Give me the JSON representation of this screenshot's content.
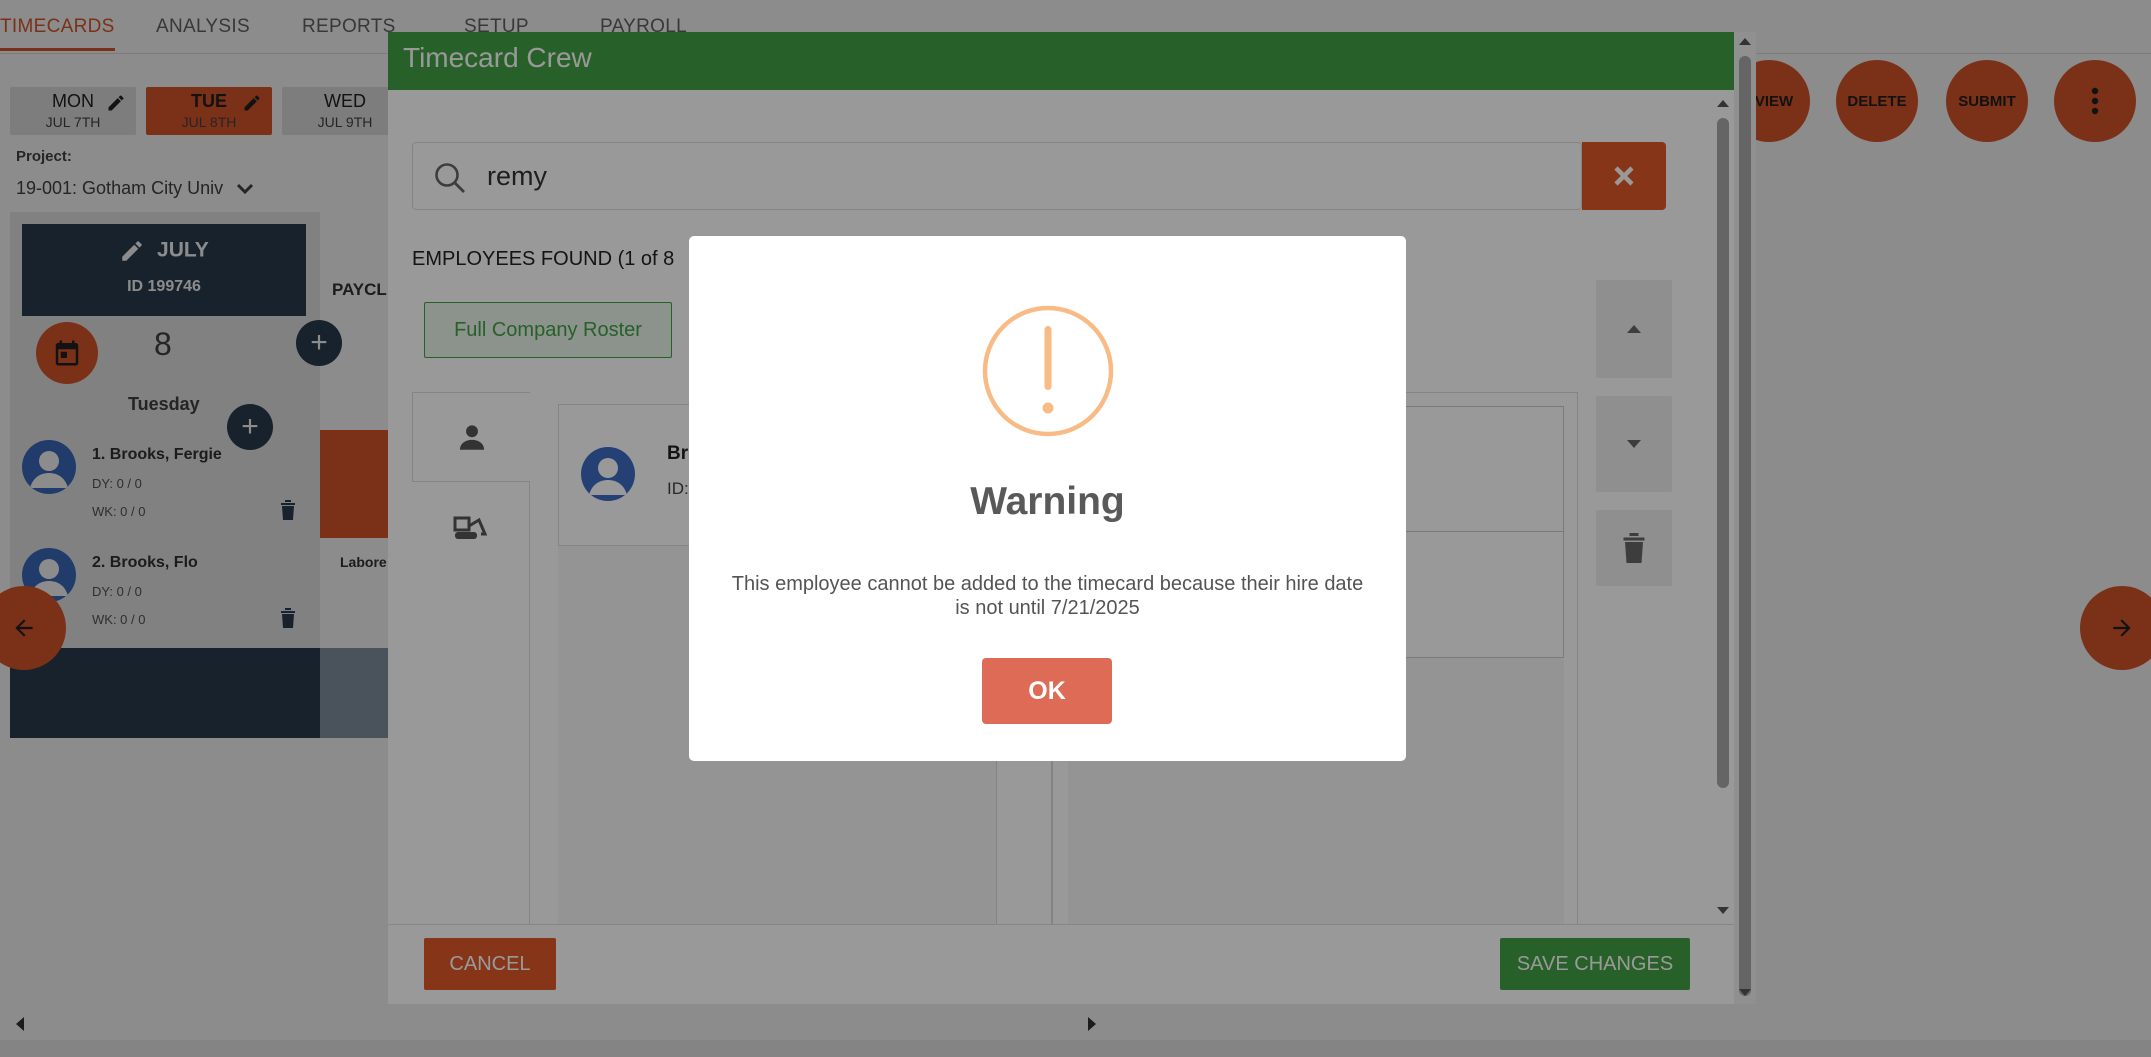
{
  "nav": {
    "tabs": [
      "TIMECARDS",
      "ANALYSIS",
      "REPORTS",
      "SETUP",
      "PAYROLL"
    ]
  },
  "days": [
    {
      "name": "MON",
      "date": "JUL 7TH"
    },
    {
      "name": "TUE",
      "date": "JUL 8TH"
    },
    {
      "name": "WED",
      "date": "JUL 9TH"
    }
  ],
  "toolbar": {
    "review": "EVIEW",
    "delete": "DELETE",
    "submit": "SUBMIT"
  },
  "project": {
    "label": "Project:",
    "value": "19-001: Gotham City Univ"
  },
  "column": {
    "name": "JULY",
    "id": "ID 199746",
    "day_number": "8",
    "weekday": "Tuesday",
    "paycl_label": "PAYCL",
    "labor_label": "Labore"
  },
  "employees_bg": [
    {
      "name": "1. Brooks, Fergie",
      "dy": "DY: 0 / 0",
      "wk": "WK: 0 / 0"
    },
    {
      "name": "2. Brooks, Flo",
      "dy": "DY: 0 / 0",
      "wk": "WK: 0 / 0"
    }
  ],
  "crew_modal": {
    "title": "Timecard Crew",
    "search_value": "remy",
    "found_text": "EMPLOYEES FOUND (1 of 8",
    "roster_button": "Full Company Roster",
    "result_name": "Br",
    "result_id": "ID:",
    "cancel": "CANCEL",
    "save": "SAVE CHANGES"
  },
  "warning": {
    "title": "Warning",
    "message": "This employee cannot be added to the timecard because their hire date is not until 7/21/2025",
    "ok": "OK",
    "icon_color": "#f8bb86",
    "button_color": "#dd6b55"
  },
  "colors": {
    "accent": "#e0592a",
    "green": "#43a047",
    "navy": "#2c3e50"
  }
}
